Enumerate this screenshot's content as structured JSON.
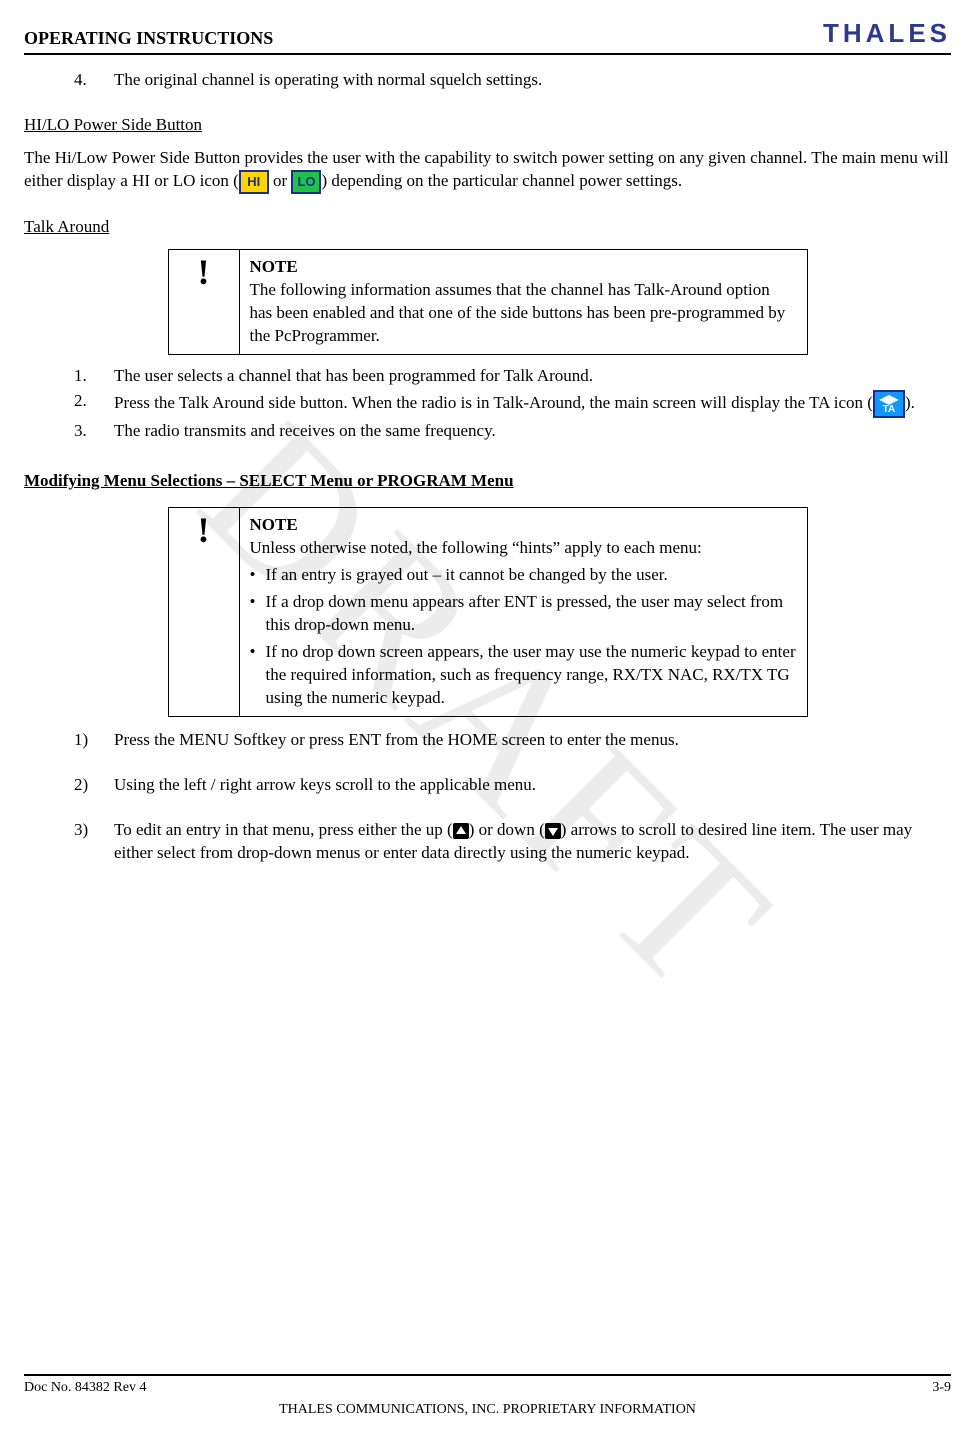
{
  "header": {
    "section": "OPERATING INSTRUCTIONS",
    "brand": "THALES"
  },
  "watermark": "DRAFT",
  "item4": {
    "num": "4.",
    "text": "The original channel is operating with normal squelch settings."
  },
  "hilo": {
    "heading": "HI/LO Power Side Button",
    "p1a": "The Hi/Low Power Side Button provides the user with the capability to switch power setting on any given channel.   The main menu will either display a HI or LO icon (",
    "p1b": " or  ",
    "p1c": ") depending on the particular channel power settings.",
    "hi_label": "HI",
    "lo_label": "LO"
  },
  "talk": {
    "heading": "Talk Around",
    "note_title": "NOTE",
    "note_body": "The following information assumes that the channel has Talk-Around option has been enabled and that one of the side buttons has been pre-programmed by the PcProgrammer.",
    "items": {
      "n1": "1.",
      "t1": "The user selects a channel that has been programmed for Talk Around.",
      "n2": "2.",
      "t2a": "Press the Talk Around side button.  When the radio is in Talk-Around, the main screen will display the TA icon (",
      "t2b": ").",
      "ta_top": "◀▶",
      "ta_bot": "TA",
      "n3": "3.",
      "t3": "The radio transmits and receives on the same frequency."
    }
  },
  "modify": {
    "heading": "Modifying Menu Selections – SELECT Menu or PROGRAM Menu",
    "note_title": "NOTE",
    "note_intro": "Unless otherwise noted, the following “hints” apply to each menu:",
    "b1": "If an entry is grayed out – it cannot be changed by the user.",
    "b2": "If a drop down menu appears after ENT is pressed, the user may select from this drop-down menu.",
    "b3": "If no drop down screen appears, the user may use the numeric keypad to enter the required information, such as frequency range, RX/TX NAC, RX/TX TG using the numeric keypad.",
    "steps": {
      "n1": "1)",
      "t1": "Press the MENU Softkey or press ENT from the HOME screen to enter the menus.",
      "n2": "2)",
      "t2": "Using the left / right arrow keys scroll to the applicable menu.",
      "n3": "3)",
      "t3a": "To edit an entry in that menu, press either the up (",
      "t3b": ") or down (",
      "t3c": ") arrows to scroll to desired line item. The user may either select from drop-down menus or enter data directly using the numeric keypad."
    }
  },
  "footer": {
    "doc": "Doc No. 84382 Rev 4",
    "page": "3-9",
    "prop": "THALES COMMUNICATIONS, INC. PROPRIETARY INFORMATION"
  }
}
